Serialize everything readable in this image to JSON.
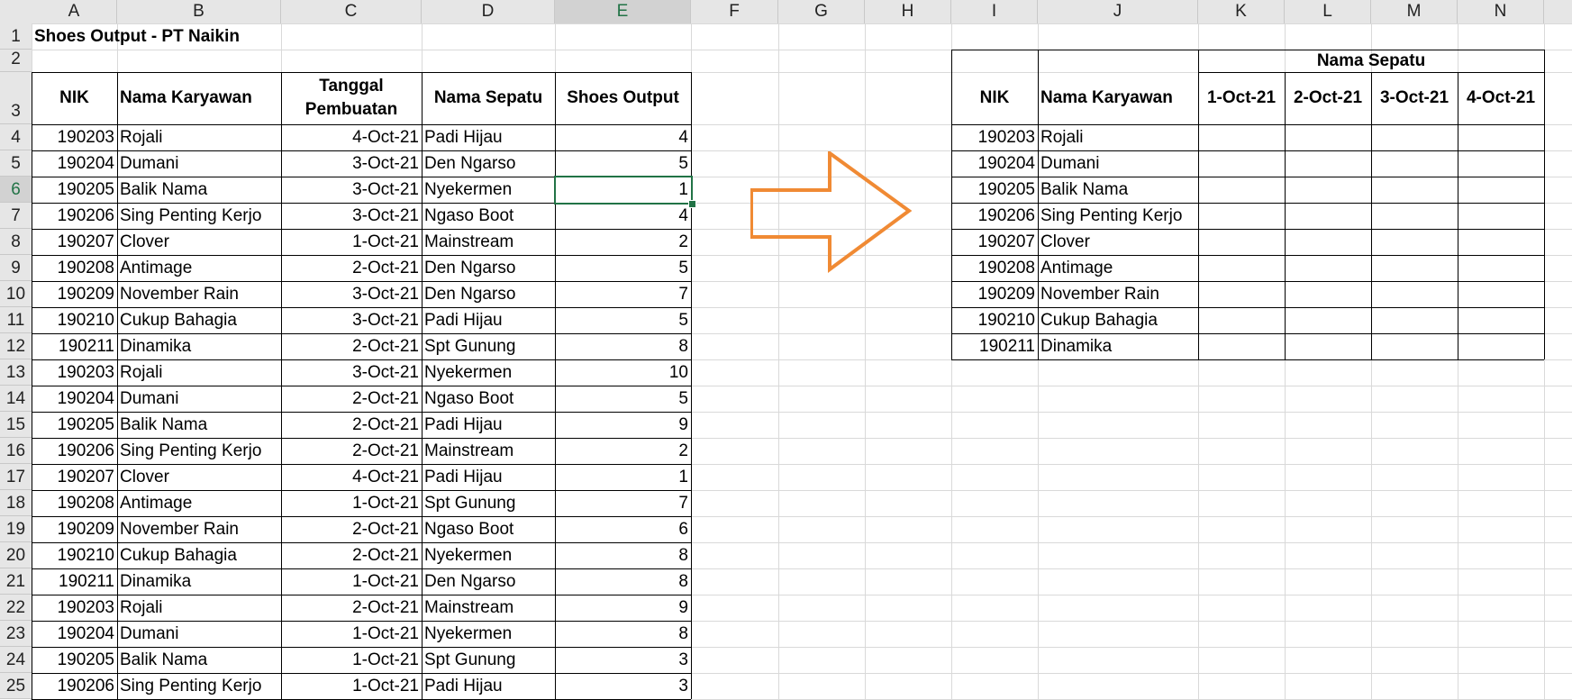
{
  "columns": [
    "A",
    "B",
    "C",
    "D",
    "E",
    "F",
    "G",
    "H",
    "I",
    "J",
    "K",
    "L",
    "M",
    "N"
  ],
  "rows": [
    "1",
    "2",
    "3",
    "4",
    "5",
    "6",
    "7",
    "8",
    "9",
    "10",
    "11",
    "12",
    "13",
    "14",
    "15",
    "16",
    "17",
    "18",
    "19",
    "20",
    "21",
    "22",
    "23",
    "24",
    "25"
  ],
  "selected_cell": {
    "col": "E",
    "row": "6"
  },
  "colors": {
    "header_bg": "#e6e6e6",
    "selected_header_bg": "#d2d2d2",
    "selected_accent": "#217346",
    "grid_line": "#d9d9d9",
    "arrow": "#f08a34"
  },
  "sheet_title": "Shoes Output - PT Naikin",
  "left_table": {
    "headers": {
      "nik": "NIK",
      "nama": "Nama Karyawan",
      "tanggal": "Tanggal Pembuatan",
      "sepatu": "Nama Sepatu",
      "output": "Shoes Output"
    },
    "rows": [
      {
        "nik": "190203",
        "nama": "Rojali",
        "tanggal": "4-Oct-21",
        "sepatu": "Padi Hijau",
        "output": "4"
      },
      {
        "nik": "190204",
        "nama": "Dumani",
        "tanggal": "3-Oct-21",
        "sepatu": "Den Ngarso",
        "output": "5"
      },
      {
        "nik": "190205",
        "nama": "Balik Nama",
        "tanggal": "3-Oct-21",
        "sepatu": "Nyekermen",
        "output": "1"
      },
      {
        "nik": "190206",
        "nama": "Sing Penting Kerjo",
        "tanggal": "3-Oct-21",
        "sepatu": "Ngaso Boot",
        "output": "4"
      },
      {
        "nik": "190207",
        "nama": "Clover",
        "tanggal": "1-Oct-21",
        "sepatu": "Mainstream",
        "output": "2"
      },
      {
        "nik": "190208",
        "nama": "Antimage",
        "tanggal": "2-Oct-21",
        "sepatu": "Den Ngarso",
        "output": "5"
      },
      {
        "nik": "190209",
        "nama": "November Rain",
        "tanggal": "3-Oct-21",
        "sepatu": "Den Ngarso",
        "output": "7"
      },
      {
        "nik": "190210",
        "nama": "Cukup Bahagia",
        "tanggal": "3-Oct-21",
        "sepatu": "Padi Hijau",
        "output": "5"
      },
      {
        "nik": "190211",
        "nama": "Dinamika",
        "tanggal": "2-Oct-21",
        "sepatu": "Spt Gunung",
        "output": "8"
      },
      {
        "nik": "190203",
        "nama": "Rojali",
        "tanggal": "3-Oct-21",
        "sepatu": "Nyekermen",
        "output": "10"
      },
      {
        "nik": "190204",
        "nama": "Dumani",
        "tanggal": "2-Oct-21",
        "sepatu": "Ngaso Boot",
        "output": "5"
      },
      {
        "nik": "190205",
        "nama": "Balik Nama",
        "tanggal": "2-Oct-21",
        "sepatu": "Padi Hijau",
        "output": "9"
      },
      {
        "nik": "190206",
        "nama": "Sing Penting Kerjo",
        "tanggal": "2-Oct-21",
        "sepatu": "Mainstream",
        "output": "2"
      },
      {
        "nik": "190207",
        "nama": "Clover",
        "tanggal": "4-Oct-21",
        "sepatu": "Padi Hijau",
        "output": "1"
      },
      {
        "nik": "190208",
        "nama": "Antimage",
        "tanggal": "1-Oct-21",
        "sepatu": "Spt Gunung",
        "output": "7"
      },
      {
        "nik": "190209",
        "nama": "November Rain",
        "tanggal": "2-Oct-21",
        "sepatu": "Ngaso Boot",
        "output": "6"
      },
      {
        "nik": "190210",
        "nama": "Cukup Bahagia",
        "tanggal": "2-Oct-21",
        "sepatu": "Nyekermen",
        "output": "8"
      },
      {
        "nik": "190211",
        "nama": "Dinamika",
        "tanggal": "1-Oct-21",
        "sepatu": "Den Ngarso",
        "output": "8"
      },
      {
        "nik": "190203",
        "nama": "Rojali",
        "tanggal": "2-Oct-21",
        "sepatu": "Mainstream",
        "output": "9"
      },
      {
        "nik": "190204",
        "nama": "Dumani",
        "tanggal": "1-Oct-21",
        "sepatu": "Nyekermen",
        "output": "8"
      },
      {
        "nik": "190205",
        "nama": "Balik Nama",
        "tanggal": "1-Oct-21",
        "sepatu": "Spt Gunung",
        "output": "3"
      },
      {
        "nik": "190206",
        "nama": "Sing Penting Kerjo",
        "tanggal": "1-Oct-21",
        "sepatu": "Padi Hijau",
        "output": "3"
      }
    ]
  },
  "right_table": {
    "group_header": "Nama Sepatu",
    "headers": {
      "nik": "NIK",
      "nama": "Nama Karyawan",
      "dates": [
        "1-Oct-21",
        "2-Oct-21",
        "3-Oct-21",
        "4-Oct-21"
      ]
    },
    "rows": [
      {
        "nik": "190203",
        "nama": "Rojali"
      },
      {
        "nik": "190204",
        "nama": "Dumani"
      },
      {
        "nik": "190205",
        "nama": "Balik Nama"
      },
      {
        "nik": "190206",
        "nama": "Sing Penting Kerjo"
      },
      {
        "nik": "190207",
        "nama": "Clover"
      },
      {
        "nik": "190208",
        "nama": "Antimage"
      },
      {
        "nik": "190209",
        "nama": "November Rain"
      },
      {
        "nik": "190210",
        "nama": "Cukup Bahagia"
      },
      {
        "nik": "190211",
        "nama": "Dinamika"
      }
    ]
  },
  "arrow_icon": "right-arrow-outline"
}
